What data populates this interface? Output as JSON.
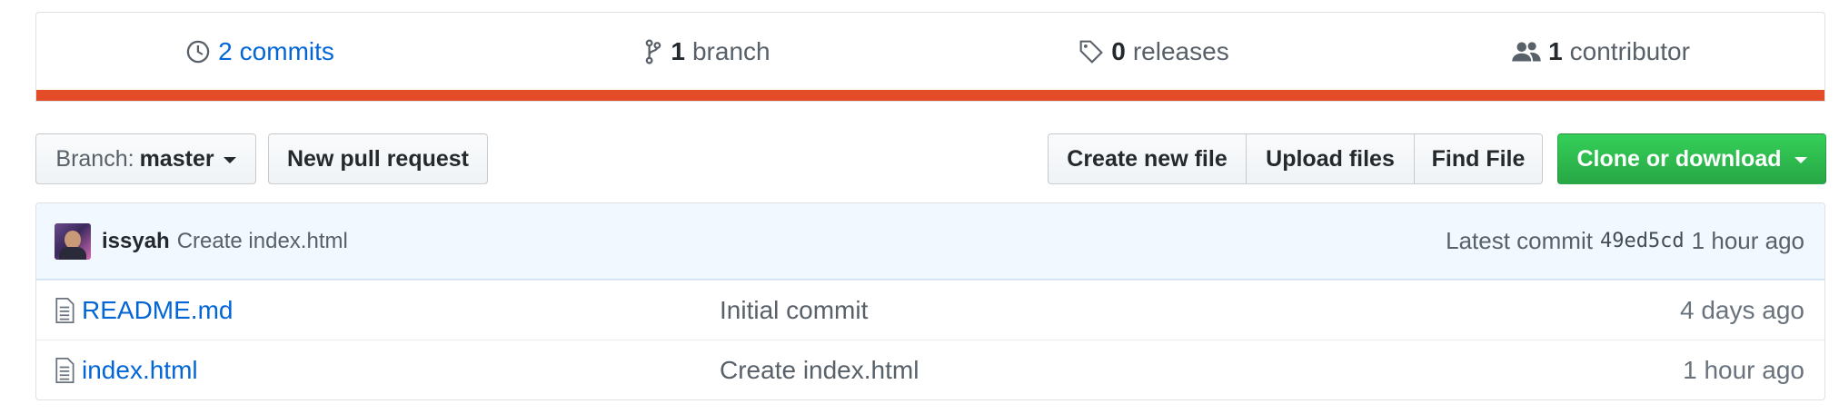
{
  "summary": {
    "commits": {
      "count": "2",
      "label": "commits",
      "icon": "history-icon"
    },
    "branches": {
      "count": "1",
      "label": "branch",
      "icon": "git-branch-icon"
    },
    "releases": {
      "count": "0",
      "label": "releases",
      "icon": "tag-icon"
    },
    "contributors": {
      "count": "1",
      "label": "contributor",
      "icon": "people-icon"
    },
    "language_bar_color": "#e34c26"
  },
  "actions": {
    "branch_label": "Branch:",
    "branch_value": "master",
    "new_pull_request": "New pull request",
    "create_new_file": "Create new file",
    "upload_files": "Upload files",
    "find_file": "Find File",
    "clone_or_download": "Clone or download"
  },
  "latest_commit": {
    "author": "issyah",
    "message": "Create index.html",
    "prefix": "Latest commit",
    "sha": "49ed5cd",
    "age": "1 hour ago"
  },
  "files": [
    {
      "name": "README.md",
      "message": "Initial commit",
      "age": "4 days ago",
      "icon": "file-text-icon"
    },
    {
      "name": "index.html",
      "message": "Create index.html",
      "age": "1 hour ago",
      "icon": "file-text-icon"
    }
  ],
  "colors": {
    "link": "#0366d6",
    "primary_button": "#28a745",
    "commit_tease_bg": "#f1f8ff"
  }
}
